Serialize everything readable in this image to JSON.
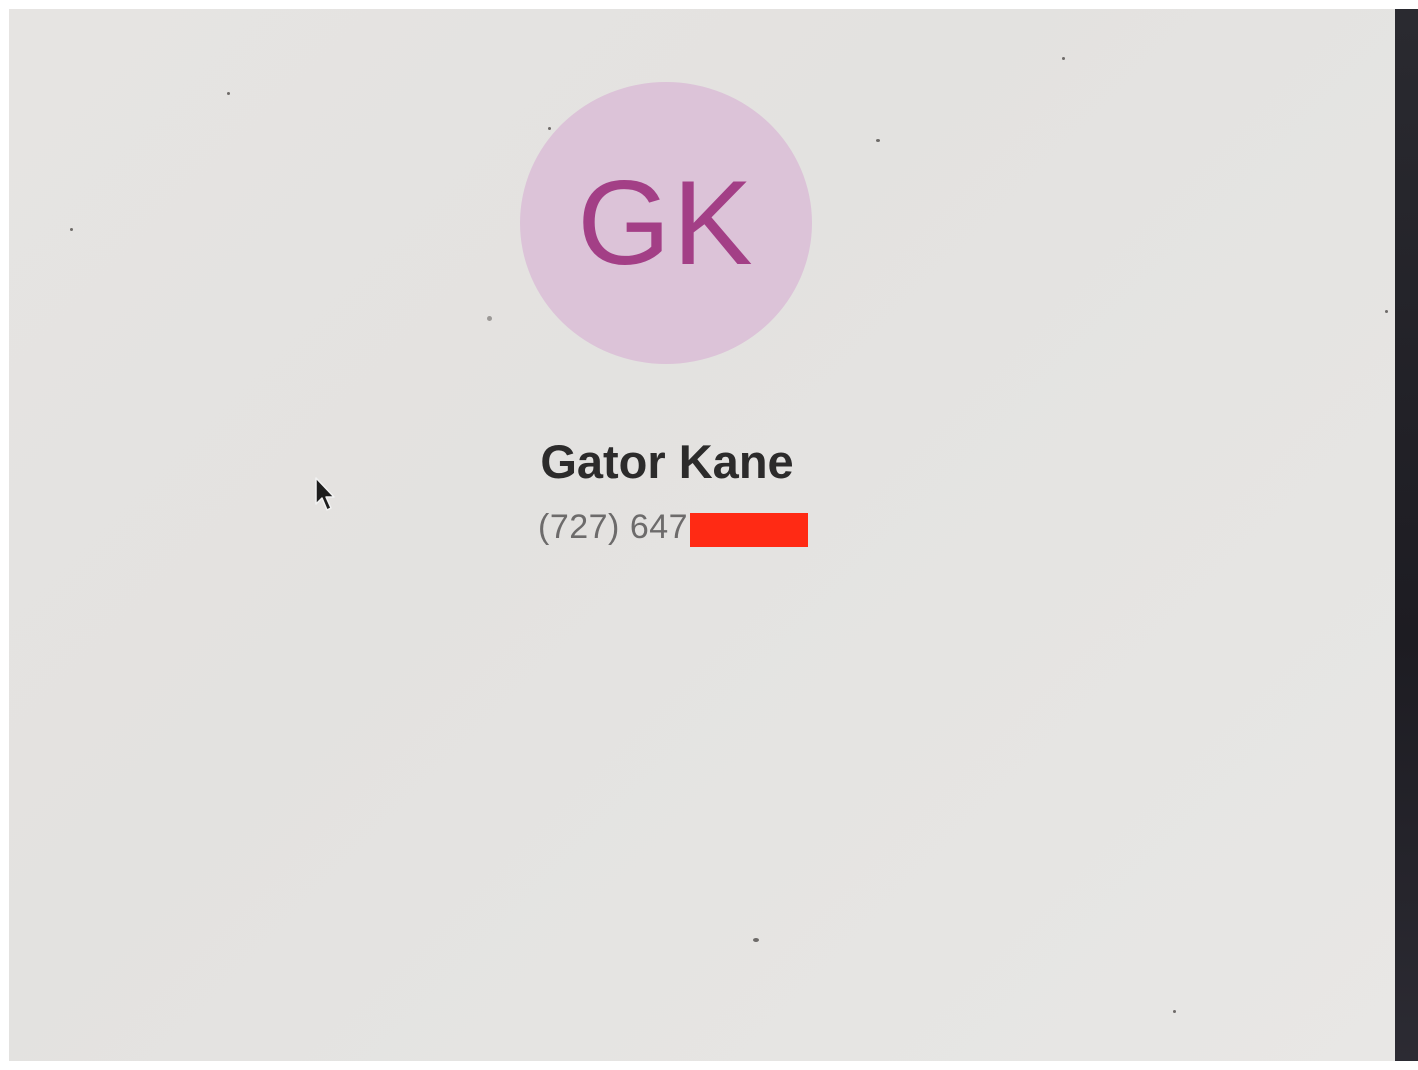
{
  "contact": {
    "initials": "GK",
    "name": "Gator Kane",
    "phone_visible": "(727) 647"
  },
  "icons": {
    "cursor": "mouse-pointer-icon",
    "redaction": "redaction-bar"
  },
  "colors": {
    "avatar_bg": "#dcc3d8",
    "avatar_text": "#a33f86",
    "name_text": "#2c2b2b",
    "phone_text": "#6d6b6b",
    "redaction": "#ff2a14"
  }
}
